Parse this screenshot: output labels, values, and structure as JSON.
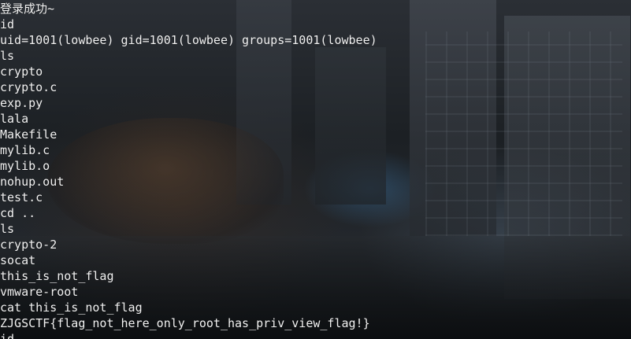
{
  "terminal": {
    "lines": [
      "登录成功~",
      "id",
      "uid=1001(lowbee) gid=1001(lowbee) groups=1001(lowbee)",
      "ls",
      "crypto",
      "crypto.c",
      "exp.py",
      "lala",
      "Makefile",
      "mylib.c",
      "mylib.o",
      "nohup.out",
      "test.c",
      "cd ..",
      "ls",
      "crypto-2",
      "socat",
      "this_is_not_flag",
      "vmware-root",
      "cat this_is_not_flag",
      "ZJGSCTF{flag_not_here_only_root_has_priv_view_flag!}",
      "id"
    ]
  }
}
